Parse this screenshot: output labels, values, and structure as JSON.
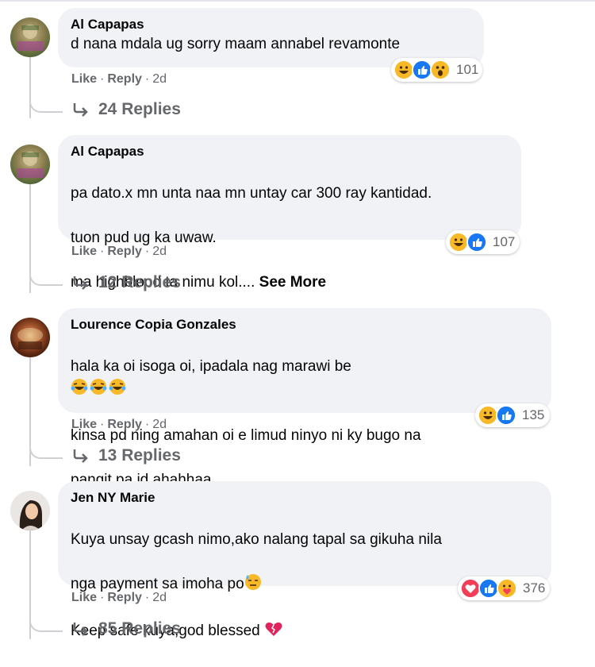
{
  "actions": {
    "like": "Like",
    "reply": "Reply",
    "separator": "·"
  },
  "comments": [
    {
      "author": "Al Capapas",
      "lines": [
        "d nana mdala ug sorry maam annabel revamonte"
      ],
      "see_more": "",
      "time": "2d",
      "reaction_icons": [
        "haha",
        "like",
        "wow"
      ],
      "reaction_count": "101",
      "replies": "24 Replies"
    },
    {
      "author": "Al Capapas",
      "lines": [
        "pa dato.x mn unta naa mn untay car 300 ray kantidad.",
        "tuon pud ug ka uwaw.",
        "ma highblood ta nimu kol.... "
      ],
      "see_more": "See More",
      "time": "2d",
      "reaction_icons": [
        "haha",
        "like"
      ],
      "reaction_count": "107",
      "replies": "12 Replies"
    },
    {
      "author": "Lourence Copia Gonzales",
      "lines": [
        "hala ka oi isoga oi, ipadala nag marawi be",
        "kinsa pd ning amahan oi e limud ninyo ni ky bugo na",
        "pangit pa jd ahahhaa"
      ],
      "see_more": "",
      "time": "2d",
      "reaction_icons": [
        "haha",
        "like"
      ],
      "reaction_count": "135",
      "replies": "13 Replies"
    },
    {
      "author": "Jen NY Marie",
      "lines": [
        "Kuya unsay gcash nimo,ako nalang tapal sa gikuha nila",
        "nga payment sa imoha po",
        "Keep safe kuya,god blessed"
      ],
      "see_more": "",
      "time": "2d",
      "reaction_icons": [
        "love",
        "like",
        "care"
      ],
      "reaction_count": "376",
      "replies": "85 Replies"
    }
  ],
  "colors": {
    "bubble": "#f0f2f5",
    "secondary_text": "#65676b",
    "like_blue": "#1877f2",
    "love_red": "#f33e58",
    "haha_yellow": "#f7b928"
  }
}
